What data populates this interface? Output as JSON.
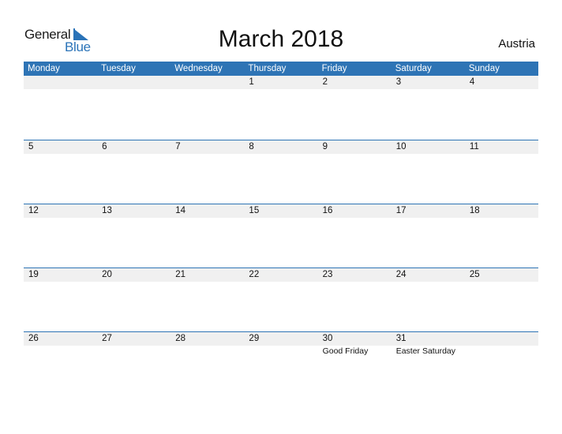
{
  "logo": {
    "line1": "General",
    "line2": "Blue"
  },
  "title": "March 2018",
  "country": "Austria",
  "colors": {
    "accent": "#2e74b5",
    "band": "#f0f0f0"
  },
  "weekdays": [
    "Monday",
    "Tuesday",
    "Wednesday",
    "Thursday",
    "Friday",
    "Saturday",
    "Sunday"
  ],
  "weeks": [
    {
      "days": [
        "",
        "",
        "",
        "1",
        "2",
        "3",
        "4"
      ],
      "events": [
        "",
        "",
        "",
        "",
        "",
        "",
        ""
      ]
    },
    {
      "days": [
        "5",
        "6",
        "7",
        "8",
        "9",
        "10",
        "11"
      ],
      "events": [
        "",
        "",
        "",
        "",
        "",
        "",
        ""
      ]
    },
    {
      "days": [
        "12",
        "13",
        "14",
        "15",
        "16",
        "17",
        "18"
      ],
      "events": [
        "",
        "",
        "",
        "",
        "",
        "",
        ""
      ]
    },
    {
      "days": [
        "19",
        "20",
        "21",
        "22",
        "23",
        "24",
        "25"
      ],
      "events": [
        "",
        "",
        "",
        "",
        "",
        "",
        ""
      ]
    },
    {
      "days": [
        "26",
        "27",
        "28",
        "29",
        "30",
        "31",
        ""
      ],
      "events": [
        "",
        "",
        "",
        "",
        "Good Friday",
        "Easter Saturday",
        ""
      ]
    }
  ]
}
